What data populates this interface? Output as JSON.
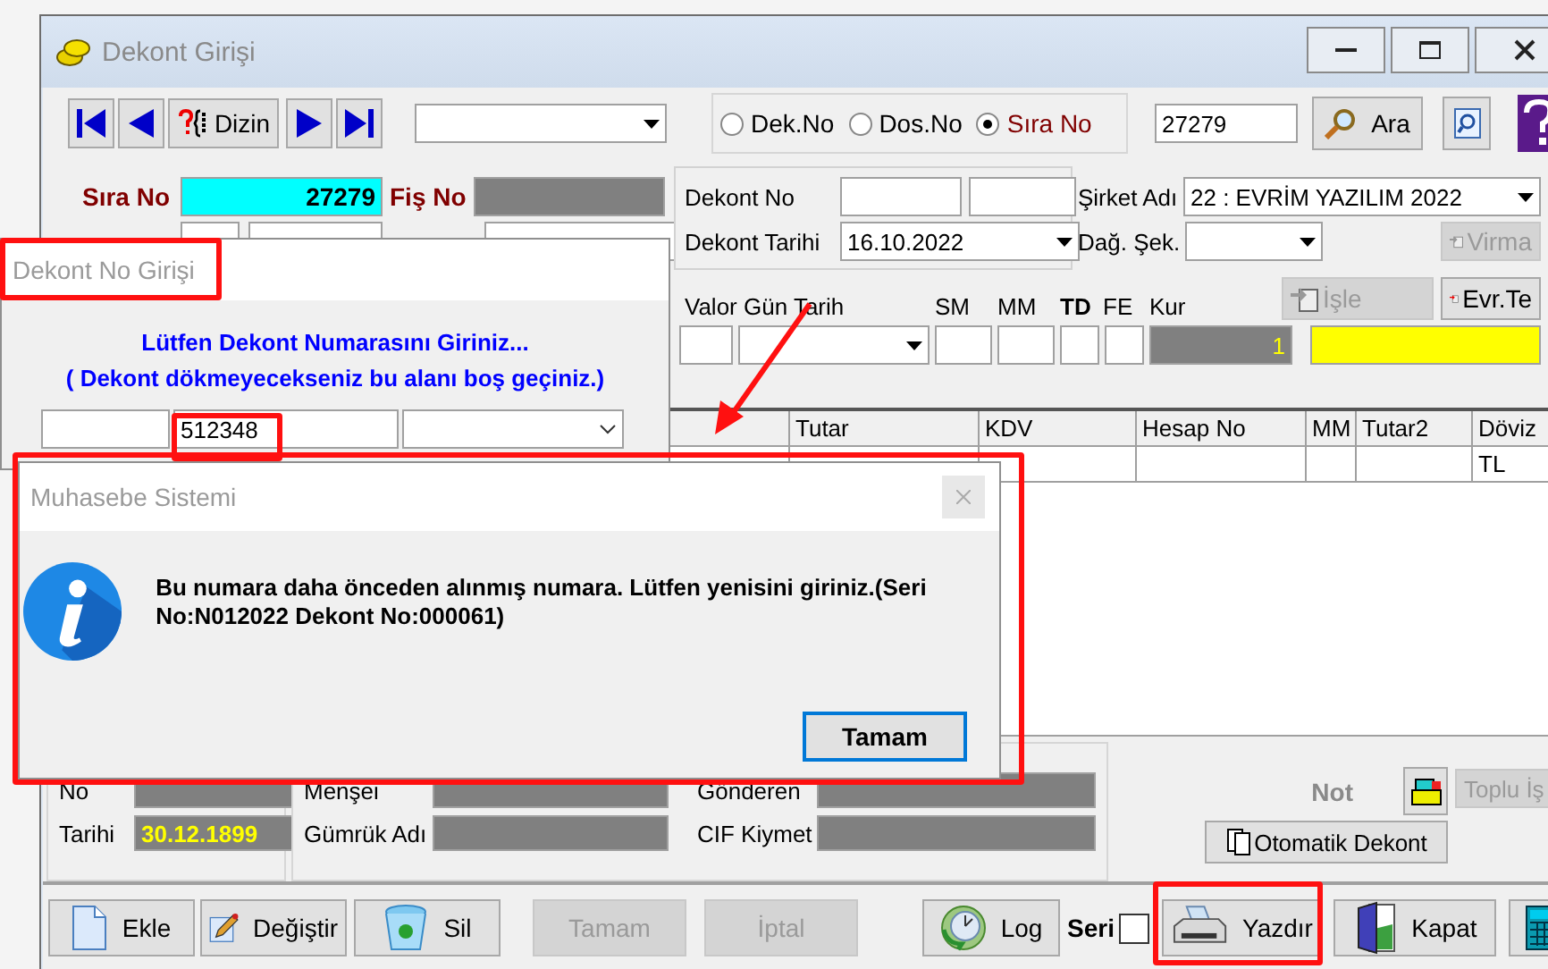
{
  "main_window": {
    "title": "Dekont Girişi"
  },
  "toolbar": {
    "nav_buttons": [
      {
        "kind": "first"
      },
      {
        "kind": "prev"
      },
      {
        "kind": "index",
        "label": "Dizin"
      },
      {
        "kind": "next"
      },
      {
        "kind": "last"
      }
    ],
    "search_by": [
      {
        "label": "Dek.No",
        "selected": false
      },
      {
        "label": "Dos.No",
        "selected": false
      },
      {
        "label": "Sıra No",
        "selected": true
      }
    ],
    "search_value": "27279",
    "search_button": "Ara"
  },
  "record": {
    "sira_no_label": "Sıra No",
    "sira_no": "27279",
    "fis_no_label": "Fiş No",
    "dekont_no_label": "Dekont No",
    "dekont_tarihi_label": "Dekont Tarihi",
    "dekont_tarihi": "16.10.2022",
    "sirket_adi_label": "Şirket Adı",
    "sirket_adi": "22 : EVRİM YAZILIM  2022",
    "dag_sek_label": "Dağ. Şek.",
    "valor_label": "Valor Gün Tarih",
    "sm_label": "SM",
    "mm_label": "MM",
    "td_label": "TD",
    "fe_label": "FE",
    "kur_label": "Kur",
    "kur": "1"
  },
  "side_buttons": [
    {
      "label": "Virma",
      "disabled": true
    },
    {
      "label": "İşle",
      "disabled": true
    },
    {
      "label": "Evr.Te",
      "disabled": false
    }
  ],
  "grid": {
    "columns": [
      "Tutar",
      "KDV",
      "Hesap No",
      "MM",
      "Tutar2",
      "Döviz"
    ],
    "rows": [
      {
        "doviz": "TL"
      }
    ]
  },
  "bottom": {
    "no_label": "No",
    "tarihi_label": "Tarihi",
    "tarihi": "30.12.1899",
    "mensei_label": "Menşei",
    "gonderen_label": "Gönderen",
    "gumruk_label": "Gümrük Adı",
    "cif_label": "CIF Kiymet",
    "not_label": "Not",
    "otomatik_button": "Otomatik Dekont",
    "toplu_button": {
      "label": "Toplu İş",
      "disabled": true
    }
  },
  "actions": [
    {
      "kind": "button",
      "label": "Ekle",
      "disabled": false
    },
    {
      "kind": "button",
      "label": "Değiştir",
      "disabled": false
    },
    {
      "kind": "button",
      "label": "Sil",
      "disabled": false
    },
    {
      "kind": "button",
      "label": "Tamam",
      "disabled": true
    },
    {
      "kind": "button",
      "label": "İptal",
      "disabled": true
    },
    {
      "kind": "button",
      "label": "Log",
      "disabled": false
    },
    {
      "kind": "checkbox",
      "label": "Seri",
      "checked": false
    },
    {
      "kind": "button",
      "label": "Yazdır",
      "disabled": false
    },
    {
      "kind": "button",
      "label": "Kapat",
      "disabled": false
    },
    {
      "kind": "button",
      "disabled": false
    }
  ],
  "dekont_dialog": {
    "title": "Dekont No Girişi",
    "prompt": "Lütfen Dekont Numarasını Giriniz...",
    "hint": "( Dekont dökmeyecekseniz bu alanı boş geçiniz.)",
    "number": "512348"
  },
  "message_box": {
    "title": "Muhasebe Sistemi",
    "message": "Bu numara daha önceden alınmış numara. Lütfen yenisini giriniz.(Seri No:N012022 Dekont No:000061)",
    "button": "Tamam"
  }
}
